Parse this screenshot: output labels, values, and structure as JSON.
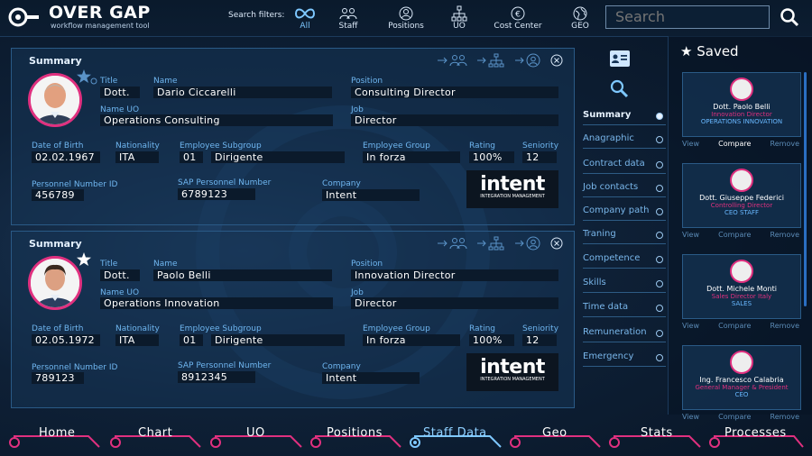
{
  "app": {
    "title": "OVER GAP",
    "subtitle": "workflow management tool"
  },
  "filters": {
    "label": "Search filters:",
    "items": [
      {
        "label": "All",
        "icon": "infinity-icon",
        "active": true
      },
      {
        "label": "Staff",
        "icon": "people-icon"
      },
      {
        "label": "Positions",
        "icon": "person-circle-icon"
      },
      {
        "label": "UO",
        "icon": "org-chart-icon"
      },
      {
        "label": "Cost Center",
        "icon": "euro-icon"
      },
      {
        "label": "GEO",
        "icon": "globe-icon"
      }
    ]
  },
  "search": {
    "placeholder": "Search"
  },
  "cards": [
    {
      "heading": "Summary",
      "title_label": "Title",
      "title": "Dott.",
      "name_label": "Name",
      "name": "Dario Ciccarelli",
      "position_label": "Position",
      "position": "Consulting Director",
      "uo_label": "Name UO",
      "uo": "Operations Consulting",
      "job_label": "Job",
      "job": "Director",
      "dob_label": "Date of Birth",
      "dob": "02.02.1967",
      "nat_label": "Nationality",
      "nat": "ITA",
      "sub_label": "Employee Subgroup",
      "sub_code": "01",
      "sub": "Dirigente",
      "group_label": "Employee Group",
      "group": "In forza",
      "rating_label": "Rating",
      "rating": "100%",
      "seniority_label": "Seniority",
      "seniority": "12",
      "pid_label": "Personnel Number ID",
      "pid": "456789",
      "sap_label": "SAP Personnel Number",
      "sap": "6789123",
      "company_label": "Company",
      "company": "Intent",
      "logo_word": "intent",
      "logo_sub": "INTEGRATION MANAGEMENT"
    },
    {
      "heading": "Summary",
      "title_label": "Title",
      "title": "Dott.",
      "name_label": "Name",
      "name": "Paolo Belli",
      "position_label": "Position",
      "position": "Innovation Director",
      "uo_label": "Name UO",
      "uo": "Operations Innovation",
      "job_label": "Job",
      "job": "Director",
      "dob_label": "Date of Birth",
      "dob": "02.05.1972",
      "nat_label": "Nationality",
      "nat": "ITA",
      "sub_label": "Employee Subgroup",
      "sub_code": "01",
      "sub": "Dirigente",
      "group_label": "Employee Group",
      "group": "In forza",
      "rating_label": "Rating",
      "rating": "100%",
      "seniority_label": "Seniority",
      "seniority": "12",
      "pid_label": "Personnel Number ID",
      "pid": "789123",
      "sap_label": "SAP Personnel Number",
      "sap": "8912345",
      "company_label": "Company",
      "company": "Intent",
      "logo_word": "intent",
      "logo_sub": "INTEGRATION MANAGEMENT"
    }
  ],
  "side_nav": [
    {
      "label": "Summary",
      "active": true
    },
    {
      "label": "Anagraphic"
    },
    {
      "label": "Contract data"
    },
    {
      "label": "Job contacts"
    },
    {
      "label": "Company path"
    },
    {
      "label": "Traning"
    },
    {
      "label": "Competence"
    },
    {
      "label": "Skills"
    },
    {
      "label": "Time data"
    },
    {
      "label": "Remuneration"
    },
    {
      "label": "Emergency"
    }
  ],
  "saved": {
    "title": "Saved",
    "actions": {
      "view": "View",
      "compare": "Compare",
      "remove": "Remove"
    },
    "items": [
      {
        "name": "Dott. Paolo Belli",
        "role": "Innovation Director",
        "dept": "OPERATIONS INNOVATION"
      },
      {
        "name": "Dott. Giuseppe Federici",
        "role": "Controlling Director",
        "dept": "CEO STAFF"
      },
      {
        "name": "Dott. Michele Monti",
        "role": "Sales Director Italy",
        "dept": "SALES"
      },
      {
        "name": "Ing. Francesco Calabria",
        "role": "General Manager & President",
        "dept": "CEO"
      }
    ]
  },
  "bottom_tabs": [
    {
      "label": "Home"
    },
    {
      "label": "Chart"
    },
    {
      "label": "UO"
    },
    {
      "label": "Positions"
    },
    {
      "label": "Staff Data",
      "active": true
    },
    {
      "label": "Geo"
    },
    {
      "label": "Stats"
    },
    {
      "label": "Processes"
    }
  ],
  "colors": {
    "accent": "#e0307f",
    "label_blue": "#6fb6f0",
    "link_blue": "#69b8ff"
  }
}
